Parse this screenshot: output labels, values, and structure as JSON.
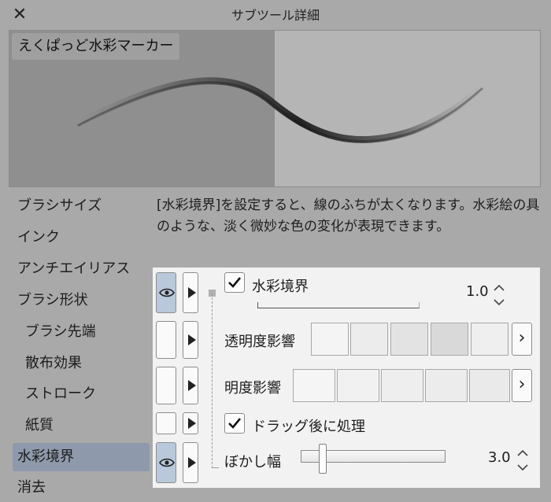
{
  "window": {
    "title": "サブツール詳細",
    "close_icon": "close-icon"
  },
  "preview": {
    "preset_name": "えくぱっど水彩マーカー"
  },
  "sidebar": {
    "items": [
      {
        "label": "ブラシサイズ",
        "sub": false,
        "active": false
      },
      {
        "label": "インク",
        "sub": false,
        "active": false
      },
      {
        "label": "アンチエイリアス",
        "sub": false,
        "active": false
      },
      {
        "label": "ブラシ形状",
        "sub": false,
        "active": false
      },
      {
        "label": "ブラシ先端",
        "sub": true,
        "active": false
      },
      {
        "label": "散布効果",
        "sub": true,
        "active": false
      },
      {
        "label": "ストローク",
        "sub": true,
        "active": false
      },
      {
        "label": "紙質",
        "sub": true,
        "active": false
      },
      {
        "label": "水彩境界",
        "sub": false,
        "active": true
      },
      {
        "label": "消去",
        "sub": false,
        "active": false
      }
    ]
  },
  "description": "[水彩境界]を設定すると、線のふちが太くなります。水彩絵の具のような、淡く微妙な色の変化が表現できます。",
  "panel": {
    "watercolor_edge": {
      "label": "水彩境界",
      "checked": true,
      "value": "1.0",
      "eye_visible": true
    },
    "opacity_effect": {
      "label": "透明度影響",
      "swatch_colors": [
        "#f4f4f4",
        "#ececec",
        "#e3e3e3",
        "#d9d9d9",
        "#efefef"
      ]
    },
    "brightness_effect": {
      "label": "明度影響",
      "swatch_colors": [
        "#f5f5f5",
        "#f1f1f1",
        "#eeeeee",
        "#ececec",
        "#eaeaea"
      ]
    },
    "process_after_drag": {
      "label": "ドラッグ後に処理",
      "checked": true
    },
    "blur_width": {
      "label": "ぼかし幅",
      "value": "3.0",
      "eye_visible": true,
      "slider_fraction": 0.15
    }
  }
}
